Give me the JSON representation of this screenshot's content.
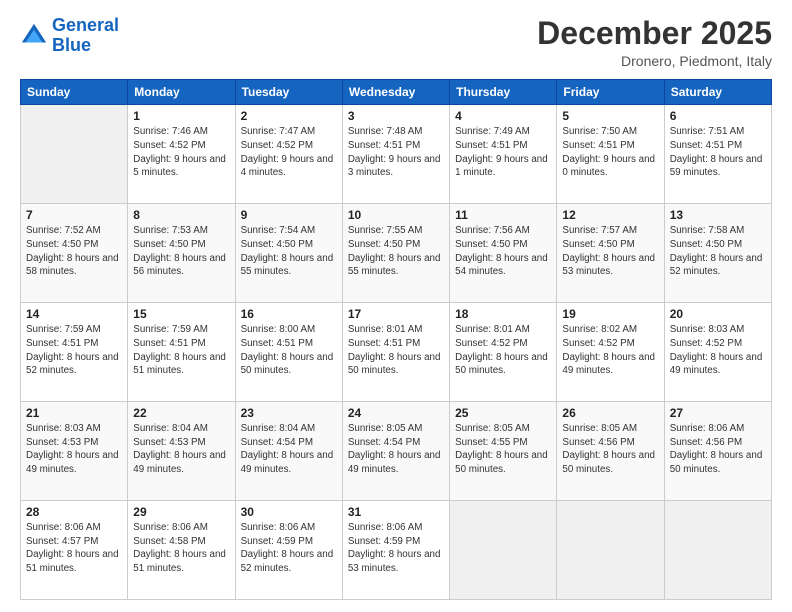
{
  "logo": {
    "line1": "General",
    "line2": "Blue"
  },
  "header": {
    "month_year": "December 2025",
    "location": "Dronero, Piedmont, Italy"
  },
  "weekdays": [
    "Sunday",
    "Monday",
    "Tuesday",
    "Wednesday",
    "Thursday",
    "Friday",
    "Saturday"
  ],
  "weeks": [
    [
      {
        "day": "",
        "sunrise": "",
        "sunset": "",
        "daylight": ""
      },
      {
        "day": "1",
        "sunrise": "Sunrise: 7:46 AM",
        "sunset": "Sunset: 4:52 PM",
        "daylight": "Daylight: 9 hours and 5 minutes."
      },
      {
        "day": "2",
        "sunrise": "Sunrise: 7:47 AM",
        "sunset": "Sunset: 4:52 PM",
        "daylight": "Daylight: 9 hours and 4 minutes."
      },
      {
        "day": "3",
        "sunrise": "Sunrise: 7:48 AM",
        "sunset": "Sunset: 4:51 PM",
        "daylight": "Daylight: 9 hours and 3 minutes."
      },
      {
        "day": "4",
        "sunrise": "Sunrise: 7:49 AM",
        "sunset": "Sunset: 4:51 PM",
        "daylight": "Daylight: 9 hours and 1 minute."
      },
      {
        "day": "5",
        "sunrise": "Sunrise: 7:50 AM",
        "sunset": "Sunset: 4:51 PM",
        "daylight": "Daylight: 9 hours and 0 minutes."
      },
      {
        "day": "6",
        "sunrise": "Sunrise: 7:51 AM",
        "sunset": "Sunset: 4:51 PM",
        "daylight": "Daylight: 8 hours and 59 minutes."
      }
    ],
    [
      {
        "day": "7",
        "sunrise": "Sunrise: 7:52 AM",
        "sunset": "Sunset: 4:50 PM",
        "daylight": "Daylight: 8 hours and 58 minutes."
      },
      {
        "day": "8",
        "sunrise": "Sunrise: 7:53 AM",
        "sunset": "Sunset: 4:50 PM",
        "daylight": "Daylight: 8 hours and 56 minutes."
      },
      {
        "day": "9",
        "sunrise": "Sunrise: 7:54 AM",
        "sunset": "Sunset: 4:50 PM",
        "daylight": "Daylight: 8 hours and 55 minutes."
      },
      {
        "day": "10",
        "sunrise": "Sunrise: 7:55 AM",
        "sunset": "Sunset: 4:50 PM",
        "daylight": "Daylight: 8 hours and 55 minutes."
      },
      {
        "day": "11",
        "sunrise": "Sunrise: 7:56 AM",
        "sunset": "Sunset: 4:50 PM",
        "daylight": "Daylight: 8 hours and 54 minutes."
      },
      {
        "day": "12",
        "sunrise": "Sunrise: 7:57 AM",
        "sunset": "Sunset: 4:50 PM",
        "daylight": "Daylight: 8 hours and 53 minutes."
      },
      {
        "day": "13",
        "sunrise": "Sunrise: 7:58 AM",
        "sunset": "Sunset: 4:50 PM",
        "daylight": "Daylight: 8 hours and 52 minutes."
      }
    ],
    [
      {
        "day": "14",
        "sunrise": "Sunrise: 7:59 AM",
        "sunset": "Sunset: 4:51 PM",
        "daylight": "Daylight: 8 hours and 52 minutes."
      },
      {
        "day": "15",
        "sunrise": "Sunrise: 7:59 AM",
        "sunset": "Sunset: 4:51 PM",
        "daylight": "Daylight: 8 hours and 51 minutes."
      },
      {
        "day": "16",
        "sunrise": "Sunrise: 8:00 AM",
        "sunset": "Sunset: 4:51 PM",
        "daylight": "Daylight: 8 hours and 50 minutes."
      },
      {
        "day": "17",
        "sunrise": "Sunrise: 8:01 AM",
        "sunset": "Sunset: 4:51 PM",
        "daylight": "Daylight: 8 hours and 50 minutes."
      },
      {
        "day": "18",
        "sunrise": "Sunrise: 8:01 AM",
        "sunset": "Sunset: 4:52 PM",
        "daylight": "Daylight: 8 hours and 50 minutes."
      },
      {
        "day": "19",
        "sunrise": "Sunrise: 8:02 AM",
        "sunset": "Sunset: 4:52 PM",
        "daylight": "Daylight: 8 hours and 49 minutes."
      },
      {
        "day": "20",
        "sunrise": "Sunrise: 8:03 AM",
        "sunset": "Sunset: 4:52 PM",
        "daylight": "Daylight: 8 hours and 49 minutes."
      }
    ],
    [
      {
        "day": "21",
        "sunrise": "Sunrise: 8:03 AM",
        "sunset": "Sunset: 4:53 PM",
        "daylight": "Daylight: 8 hours and 49 minutes."
      },
      {
        "day": "22",
        "sunrise": "Sunrise: 8:04 AM",
        "sunset": "Sunset: 4:53 PM",
        "daylight": "Daylight: 8 hours and 49 minutes."
      },
      {
        "day": "23",
        "sunrise": "Sunrise: 8:04 AM",
        "sunset": "Sunset: 4:54 PM",
        "daylight": "Daylight: 8 hours and 49 minutes."
      },
      {
        "day": "24",
        "sunrise": "Sunrise: 8:05 AM",
        "sunset": "Sunset: 4:54 PM",
        "daylight": "Daylight: 8 hours and 49 minutes."
      },
      {
        "day": "25",
        "sunrise": "Sunrise: 8:05 AM",
        "sunset": "Sunset: 4:55 PM",
        "daylight": "Daylight: 8 hours and 50 minutes."
      },
      {
        "day": "26",
        "sunrise": "Sunrise: 8:05 AM",
        "sunset": "Sunset: 4:56 PM",
        "daylight": "Daylight: 8 hours and 50 minutes."
      },
      {
        "day": "27",
        "sunrise": "Sunrise: 8:06 AM",
        "sunset": "Sunset: 4:56 PM",
        "daylight": "Daylight: 8 hours and 50 minutes."
      }
    ],
    [
      {
        "day": "28",
        "sunrise": "Sunrise: 8:06 AM",
        "sunset": "Sunset: 4:57 PM",
        "daylight": "Daylight: 8 hours and 51 minutes."
      },
      {
        "day": "29",
        "sunrise": "Sunrise: 8:06 AM",
        "sunset": "Sunset: 4:58 PM",
        "daylight": "Daylight: 8 hours and 51 minutes."
      },
      {
        "day": "30",
        "sunrise": "Sunrise: 8:06 AM",
        "sunset": "Sunset: 4:59 PM",
        "daylight": "Daylight: 8 hours and 52 minutes."
      },
      {
        "day": "31",
        "sunrise": "Sunrise: 8:06 AM",
        "sunset": "Sunset: 4:59 PM",
        "daylight": "Daylight: 8 hours and 53 minutes."
      },
      {
        "day": "",
        "sunrise": "",
        "sunset": "",
        "daylight": ""
      },
      {
        "day": "",
        "sunrise": "",
        "sunset": "",
        "daylight": ""
      },
      {
        "day": "",
        "sunrise": "",
        "sunset": "",
        "daylight": ""
      }
    ]
  ]
}
